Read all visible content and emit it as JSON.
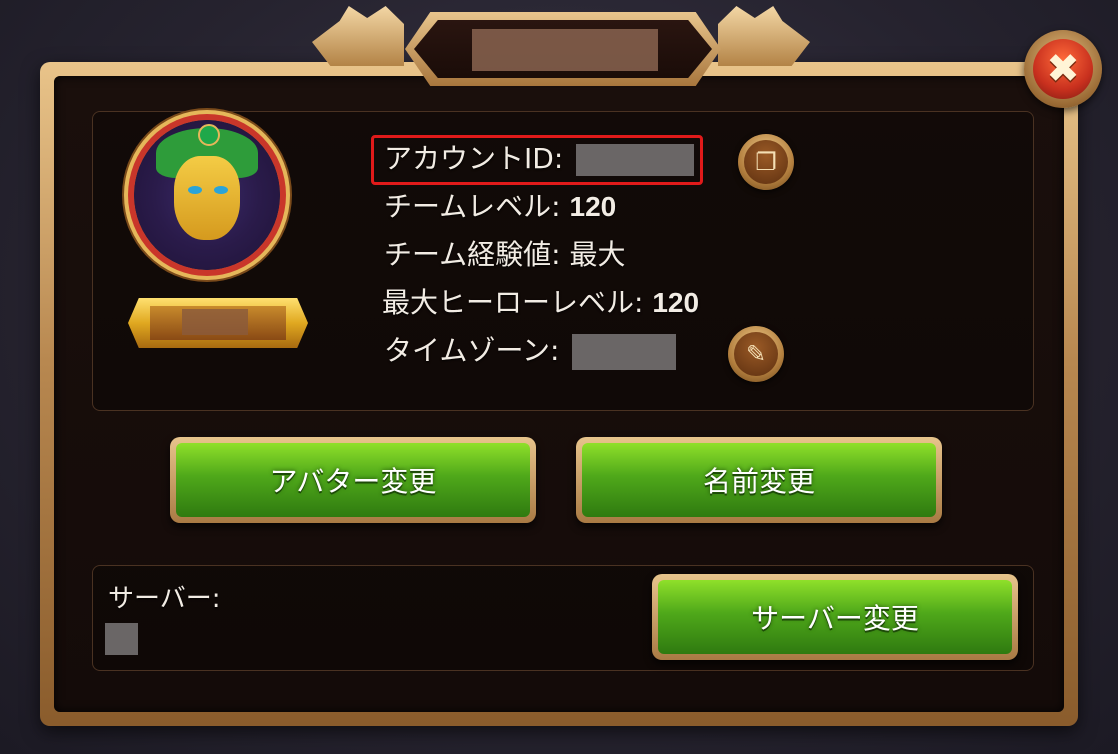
{
  "dialog": {
    "title": ""
  },
  "profile": {
    "player_name": "",
    "account_id_label": "アカウントID:",
    "account_id_value": "",
    "team_level_label": "チームレベル:",
    "team_level_value": "120",
    "team_exp_label": "チーム経験値:",
    "team_exp_value": "最大",
    "max_hero_level_label": "最大ヒーローレベル:",
    "max_hero_level_value": "120",
    "timezone_label": "タイムゾーン:",
    "timezone_value": ""
  },
  "buttons": {
    "change_avatar": "アバター変更",
    "change_name": "名前変更",
    "change_server": "サーバー変更"
  },
  "server": {
    "label": "サーバー:",
    "value": ""
  },
  "icons": {
    "close": "close-icon",
    "copy": "copy-icon",
    "edit": "pencil-icon"
  },
  "colors": {
    "highlight": "#e01a1a",
    "button_green": "#4fa81a",
    "frame_gold": "#b88850"
  }
}
